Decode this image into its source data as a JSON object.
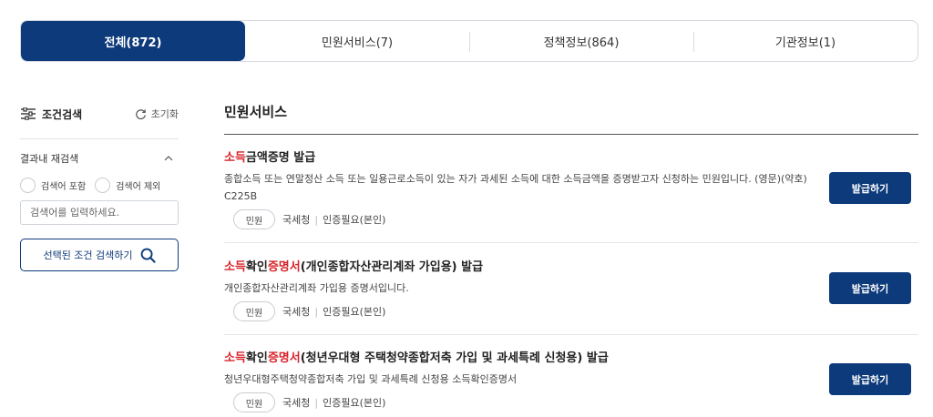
{
  "tabs": [
    {
      "label": "전체(872)",
      "active": true
    },
    {
      "label": "민원서비스(7)",
      "active": false
    },
    {
      "label": "정책정보(864)",
      "active": false
    },
    {
      "label": "기관정보(1)",
      "active": false
    }
  ],
  "sidebar": {
    "title": "조건검색",
    "reset_label": "초기화",
    "subsearch_label": "결과내 재검색",
    "radio_include": "검색어 포함",
    "radio_exclude": "검색어 제외",
    "search_placeholder": "검색어를 입력하세요.",
    "search_button": "선택된 조건 검색하기"
  },
  "main": {
    "section_title": "민원서비스",
    "items": [
      {
        "title_parts": [
          {
            "text": "소득",
            "hl": true
          },
          {
            "text": "금액증명 발급",
            "hl": false
          }
        ],
        "desc": "종합소득 또는 연말정산 소득 또는 일용근로소득이 있는 자가 과세된 소득에 대한 소득금액을 증명받고자 신청하는 민원입니다. (영문)(약호) C225B",
        "badge": "민원",
        "agency": "국세청",
        "auth": "인증필요(본인)",
        "button": "발급하기"
      },
      {
        "title_parts": [
          {
            "text": "소득",
            "hl": true
          },
          {
            "text": "확인",
            "hl": false
          },
          {
            "text": "증명서",
            "hl": true
          },
          {
            "text": "(개인종합자산관리계좌 가입용) 발급",
            "hl": false
          }
        ],
        "desc": "개인종합자산관리계좌 가입용 증명서입니다.",
        "badge": "민원",
        "agency": "국세청",
        "auth": "인증필요(본인)",
        "button": "발급하기"
      },
      {
        "title_parts": [
          {
            "text": "소득",
            "hl": true
          },
          {
            "text": "확인",
            "hl": false
          },
          {
            "text": "증명서",
            "hl": true
          },
          {
            "text": "(청년우대형 주택청약종합저축 가입 및 과세특례 신청용) 발급",
            "hl": false
          }
        ],
        "desc": "청년우대형주택청약종합저축 가입 및 과세특례 신청용 소득확인증명서",
        "badge": "민원",
        "agency": "국세청",
        "auth": "인증필요(본인)",
        "button": "발급하기"
      }
    ]
  },
  "colors": {
    "primary": "#0d3a7a",
    "highlight": "#d8232a"
  }
}
